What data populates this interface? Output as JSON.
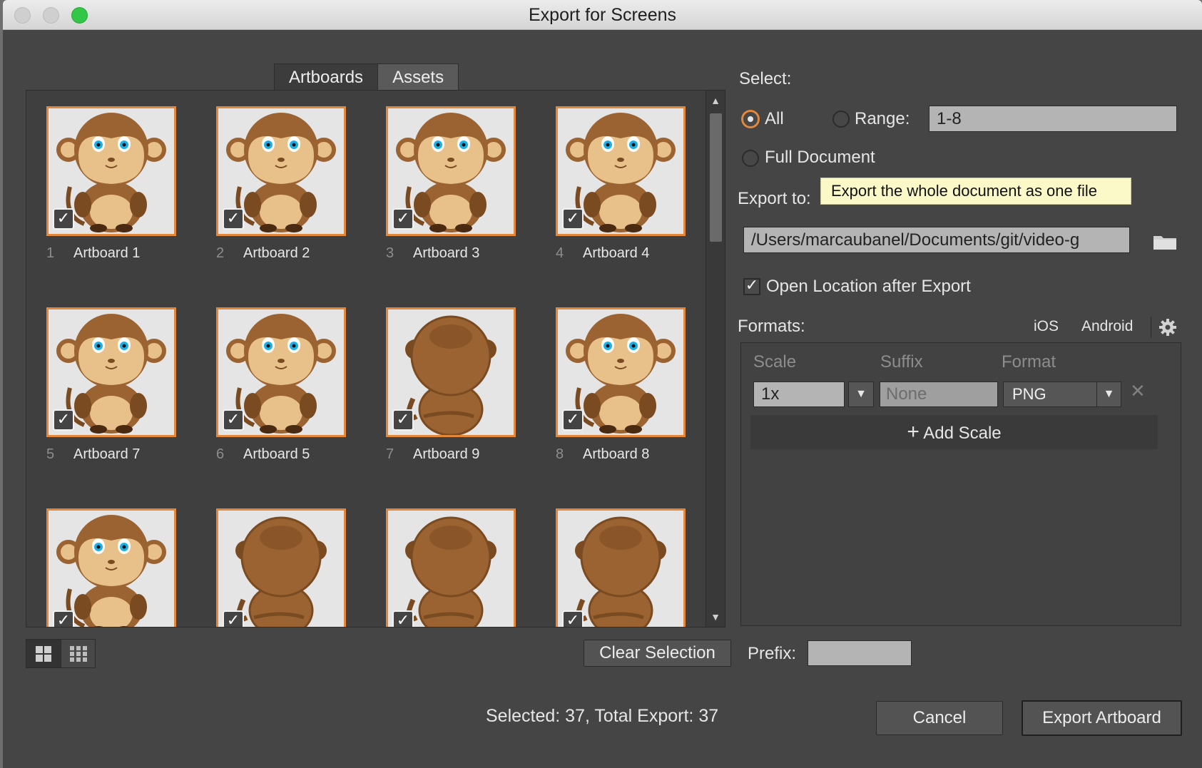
{
  "window": {
    "title": "Export for Screens"
  },
  "tabs": [
    {
      "label": "Artboards",
      "active": true
    },
    {
      "label": "Assets",
      "active": false
    }
  ],
  "artboards": [
    {
      "num": "1",
      "name": "Artboard 1",
      "checked": true,
      "pose": "front"
    },
    {
      "num": "2",
      "name": "Artboard 2",
      "checked": true,
      "pose": "front"
    },
    {
      "num": "3",
      "name": "Artboard 3",
      "checked": true,
      "pose": "front"
    },
    {
      "num": "4",
      "name": "Artboard 4",
      "checked": true,
      "pose": "front"
    },
    {
      "num": "5",
      "name": "Artboard 7",
      "checked": true,
      "pose": "front"
    },
    {
      "num": "6",
      "name": "Artboard 5",
      "checked": true,
      "pose": "front"
    },
    {
      "num": "7",
      "name": "Artboard 9",
      "checked": true,
      "pose": "back"
    },
    {
      "num": "8",
      "name": "Artboard 8",
      "checked": true,
      "pose": "front"
    },
    {
      "num": "",
      "name": "",
      "checked": true,
      "pose": "front"
    },
    {
      "num": "",
      "name": "",
      "checked": true,
      "pose": "back"
    },
    {
      "num": "",
      "name": "",
      "checked": true,
      "pose": "back"
    },
    {
      "num": "",
      "name": "",
      "checked": true,
      "pose": "back"
    }
  ],
  "view_toggle": {
    "icons": [
      "large-grid-icon",
      "small-grid-icon"
    ],
    "active": "large-grid-icon"
  },
  "clear_selection_label": "Clear Selection",
  "select": {
    "label": "Select:",
    "all_label": "All",
    "range_label": "Range:",
    "range_value": "1-8",
    "full_document_label": "Full Document",
    "selected": "All"
  },
  "tooltip": "Export the whole document as one file",
  "export_to": {
    "label": "Export to:",
    "path": "/Users/marcaubanel/Documents/git/video-g",
    "folder_icon": "folder-icon"
  },
  "open_location": {
    "label": "Open Location after Export",
    "checked": true
  },
  "formats": {
    "label": "Formats:",
    "ios_label": "iOS",
    "android_label": "Android",
    "settings_icon": "gear-icon",
    "columns": {
      "scale": "Scale",
      "suffix": "Suffix",
      "format": "Format"
    },
    "rows": [
      {
        "scale": "1x",
        "suffix_placeholder": "None",
        "format": "PNG"
      }
    ],
    "add_scale_label": "Add Scale"
  },
  "prefix": {
    "label": "Prefix:",
    "value": ""
  },
  "status": "Selected: 37, Total Export: 37",
  "buttons": {
    "cancel": "Cancel",
    "export": "Export Artboard"
  },
  "colors": {
    "accent": "#e3873a",
    "panel": "#454545",
    "close_button": "#cfcfcf",
    "zoom_button": "#33c748"
  }
}
